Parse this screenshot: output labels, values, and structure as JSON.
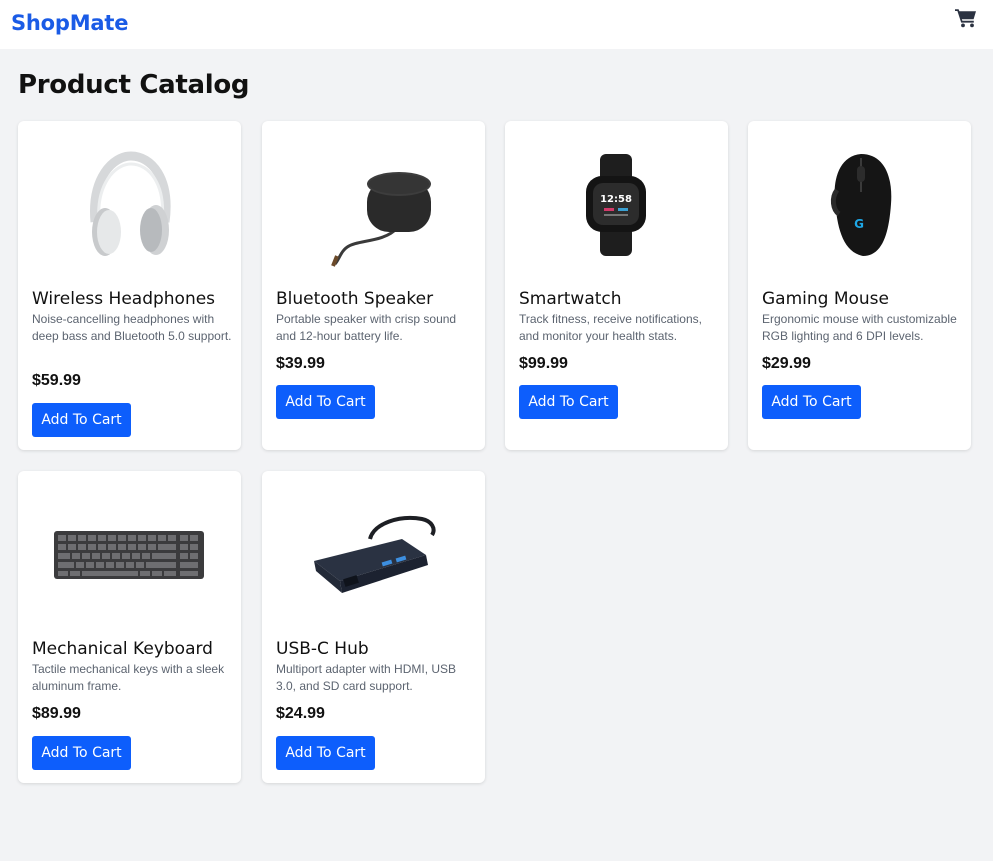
{
  "header": {
    "brand": "ShopMate",
    "cart_icon": "shopping-cart-icon",
    "brand_color": "#1a5be6"
  },
  "page": {
    "title": "Product Catalog"
  },
  "button_color": "#0d5efc",
  "products": [
    {
      "name": "Wireless Headphones",
      "description": "Noise-cancelling headphones with deep bass and Bluetooth 5.0 support.",
      "price": "$59.99",
      "button": "Add To Cart",
      "image": "headphones-image"
    },
    {
      "name": "Bluetooth Speaker",
      "description": "Portable speaker with crisp sound and 12-hour battery life.",
      "price": "$39.99",
      "button": "Add To Cart",
      "image": "speaker-image"
    },
    {
      "name": "Smartwatch",
      "description": "Track fitness, receive notifications, and monitor your health stats.",
      "price": "$99.99",
      "button": "Add To Cart",
      "image": "smartwatch-image"
    },
    {
      "name": "Gaming Mouse",
      "description": "Ergonomic mouse with customizable RGB lighting and 6 DPI levels.",
      "price": "$29.99",
      "button": "Add To Cart",
      "image": "gaming-mouse-image"
    },
    {
      "name": "Mechanical Keyboard",
      "description": "Tactile mechanical keys with a sleek aluminum frame.",
      "price": "$89.99",
      "button": "Add To Cart",
      "image": "keyboard-image"
    },
    {
      "name": "USB-C Hub",
      "description": "Multiport adapter with HDMI, USB 3.0, and SD card support.",
      "price": "$24.99",
      "button": "Add To Cart",
      "image": "usb-hub-image"
    }
  ]
}
